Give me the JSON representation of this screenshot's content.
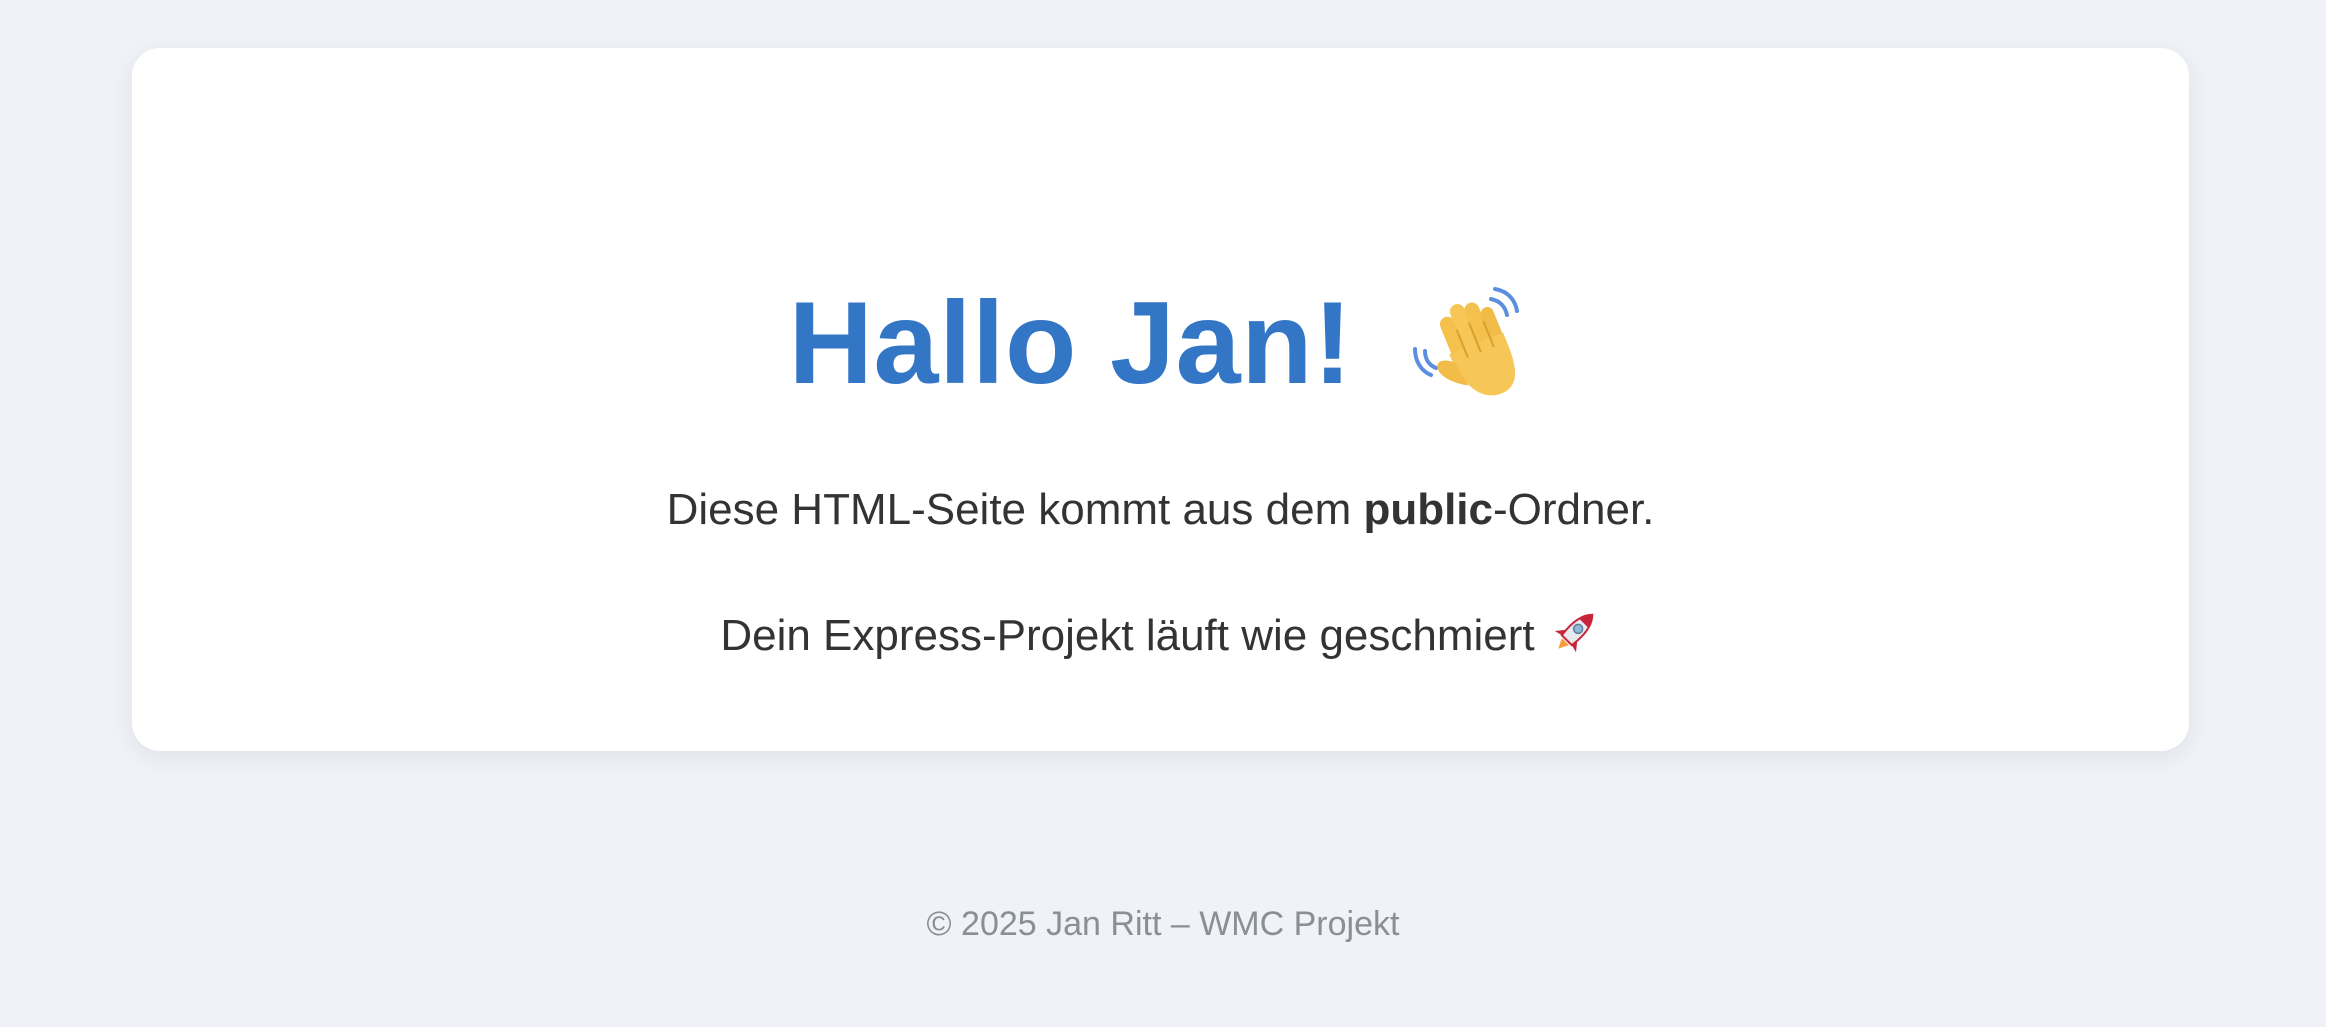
{
  "greeting": {
    "title": "Hallo Jan!",
    "icon": "waving-hand-icon"
  },
  "message": {
    "line1_prefix": "Diese HTML-Seite kommt aus dem ",
    "line1_bold": "public",
    "line1_suffix": "-Ordner.",
    "line2": "Dein Express-Projekt läuft wie geschmiert",
    "line2_icon": "rocket-icon"
  },
  "footer": {
    "text": "© 2025 Jan Ritt – WMC Projekt"
  },
  "colors": {
    "background": "#eff2f6",
    "card": "#ffffff",
    "title": "#3476c6",
    "text": "#333333",
    "footer_text": "#8a8f96"
  }
}
